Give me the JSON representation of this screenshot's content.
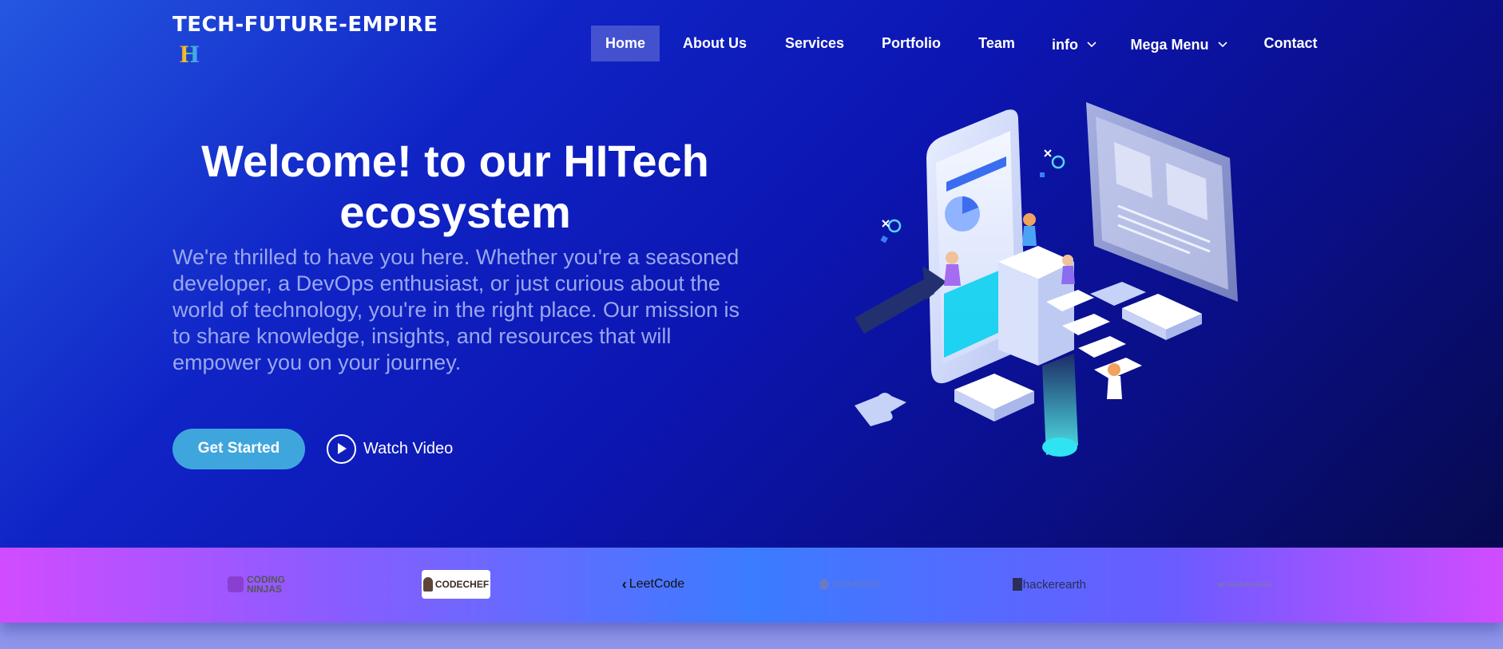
{
  "site": {
    "title": "TECH-FUTURE-EMPIRE",
    "logo_letter": "H"
  },
  "nav": {
    "items": [
      {
        "label": "Home",
        "active": true
      },
      {
        "label": "About Us"
      },
      {
        "label": "Services"
      },
      {
        "label": "Portfolio"
      },
      {
        "label": "Team"
      },
      {
        "label": "info",
        "dropdown": true
      },
      {
        "label": "Mega Menu",
        "dropdown": true
      },
      {
        "label": "Contact"
      }
    ]
  },
  "hero": {
    "heading_line1": "Welcome! to our HITech",
    "heading_line2": "ecosystem",
    "lead": "We're thrilled to have you here. Whether you're a seasoned developer, a DevOps enthusiast, or just curious about the world of technology, you're in the right place. Our mission is to share knowledge, insights, and resources that will empower you on your journey.",
    "cta_label": "Get Started",
    "video_label": "Watch Video"
  },
  "brands": [
    {
      "name": "CODING NINJAS",
      "icon": "coding-ninjas-logo"
    },
    {
      "name": "CODECHEF",
      "icon": "codechef-logo"
    },
    {
      "name": "LeetCode",
      "icon": "leetcode-logo"
    },
    {
      "name": "HackerRank",
      "icon": "hackerrank-logo"
    },
    {
      "name": "hackerearth",
      "icon": "hackerearth-logo"
    },
    {
      "name": "GeeksforGeeks",
      "icon": "geeksforgeeks-logo"
    }
  ],
  "colors": {
    "accent": "#3fa6dd",
    "nav_active_bg": "rgba(255,255,255,0.22)",
    "band_start": "#d14cff",
    "band_mid": "#3b7cff"
  }
}
